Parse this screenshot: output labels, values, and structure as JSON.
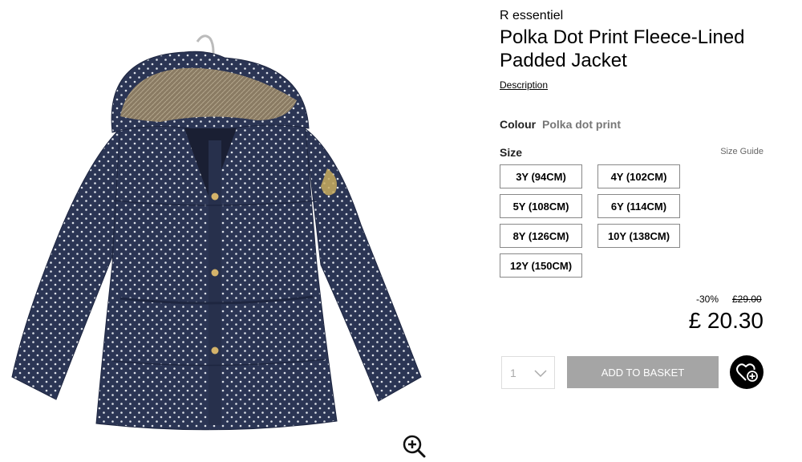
{
  "product": {
    "brand": "R essentiel",
    "title_line1": "Polka Dot Print Fleece-Lined",
    "title_line2": "Padded Jacket",
    "description_link": "Description"
  },
  "colour": {
    "label": "Colour",
    "value": "Polka dot print"
  },
  "size": {
    "label": "Size",
    "guide_label": "Size Guide",
    "options": [
      "3Y (94CM)",
      "4Y (102CM)",
      "5Y (108CM)",
      "6Y (114CM)",
      "8Y (126CM)",
      "10Y (138CM)",
      "12Y (150CM)"
    ]
  },
  "pricing": {
    "discount": "-30%",
    "old_price": "£29.00",
    "price": "£ 20.30"
  },
  "purchase": {
    "quantity": "1",
    "add_to_basket_label": "ADD TO BASKET"
  },
  "icons": {
    "zoom": "zoom-in-icon",
    "wishlist": "heart-plus-icon",
    "quantity": "chevron-down-icon"
  },
  "colors": {
    "jacket": "#2b3554",
    "dots": "#dfe3ea",
    "fur": "#8a7b63",
    "button_gray": "#a5a5a5"
  }
}
